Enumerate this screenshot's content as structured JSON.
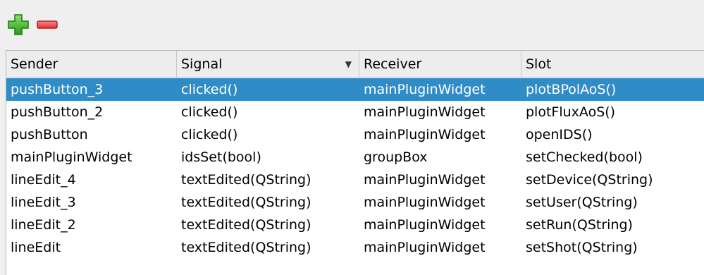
{
  "toolbar": {
    "add_icon": "green-plus-icon",
    "remove_icon": "red-minus-icon",
    "add_color": "#3bb52a",
    "remove_color": "#e04646"
  },
  "table": {
    "columns": [
      "Sender",
      "Signal",
      "Receiver",
      "Slot"
    ],
    "sorted_column": "Signal",
    "selected_row": 0,
    "selection_color": "#308cc6",
    "rows": [
      [
        "pushButton_3",
        "clicked()",
        "mainPluginWidget",
        "plotBPolAoS()"
      ],
      [
        "pushButton_2",
        "clicked()",
        "mainPluginWidget",
        "plotFluxAoS()"
      ],
      [
        "pushButton",
        "clicked()",
        "mainPluginWidget",
        "openIDS()"
      ],
      [
        "mainPluginWidget",
        "idsSet(bool)",
        "groupBox",
        "setChecked(bool)"
      ],
      [
        "lineEdit_4",
        "textEdited(QString)",
        "mainPluginWidget",
        "setDevice(QString)"
      ],
      [
        "lineEdit_3",
        "textEdited(QString)",
        "mainPluginWidget",
        "setUser(QString)"
      ],
      [
        "lineEdit_2",
        "textEdited(QString)",
        "mainPluginWidget",
        "setRun(QString)"
      ],
      [
        "lineEdit",
        "textEdited(QString)",
        "mainPluginWidget",
        "setShot(QString)"
      ]
    ]
  }
}
